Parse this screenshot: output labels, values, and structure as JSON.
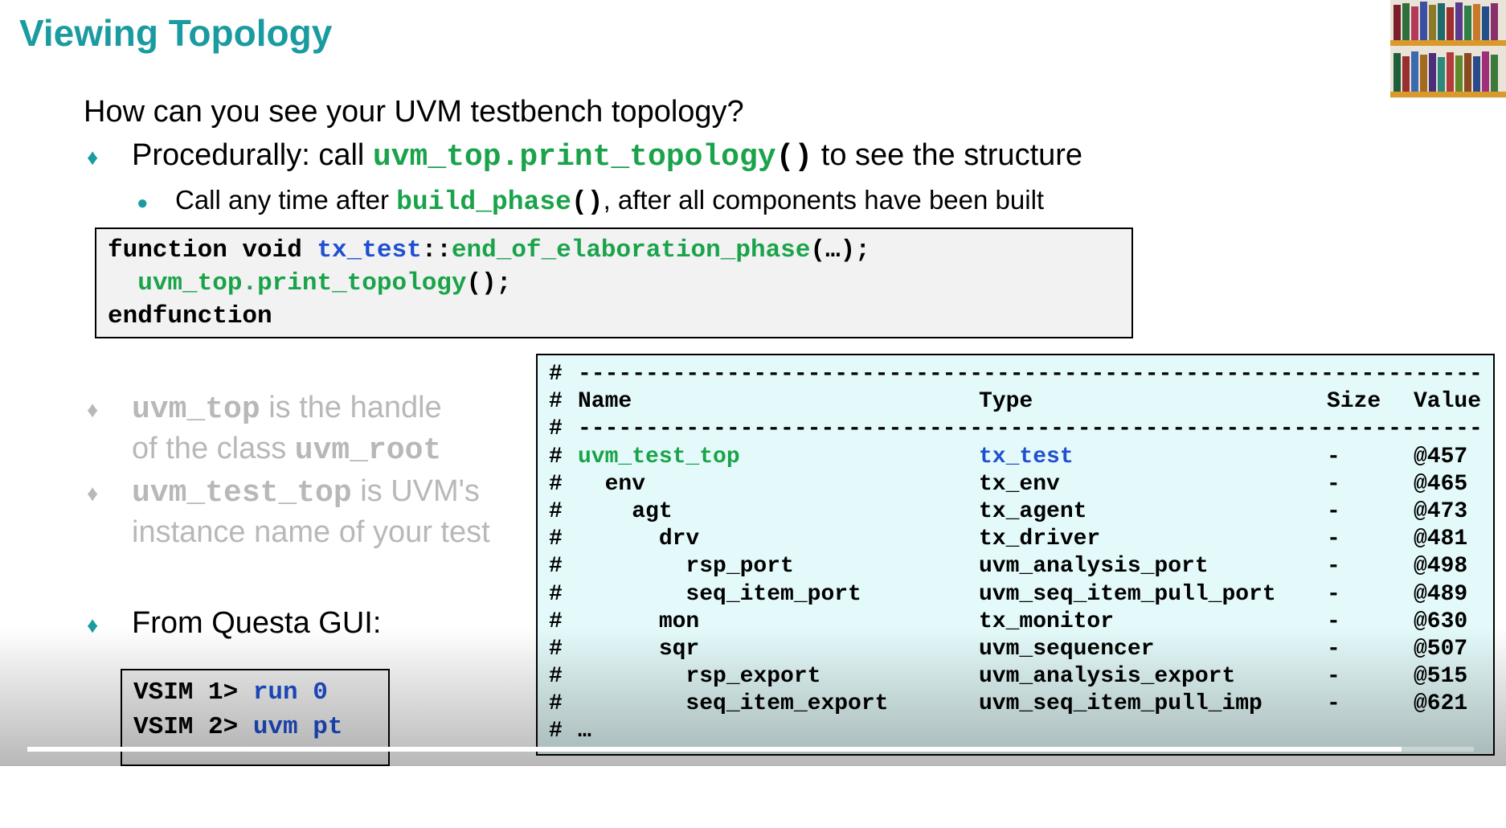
{
  "slide": {
    "title": "Viewing Topology",
    "question": "How can you see your UVM testbench topology?",
    "bullet1": {
      "prefix": "Procedurally: call ",
      "code": "uvm_top.print_topology",
      "parens": "()",
      "suffix": " to see the structure"
    },
    "sub1": {
      "prefix": "Call any time after ",
      "code": "build_phase",
      "parens": "()",
      "suffix": ", after all components have been built"
    },
    "code_block": {
      "l1_kw": "function void ",
      "l1_cls": "tx_test",
      "l1_sep": "::",
      "l1_fn": "end_of_elaboration_phase",
      "l1_tail": "(…);",
      "l2_obj": "uvm_top",
      "l2_dot": ".",
      "l2_fn": "print_topology",
      "l2_tail": "();",
      "l3": "endfunction"
    },
    "grey_bullet1": {
      "code1": "uvm_top",
      "text1": " is the handle",
      "text2": "of the class ",
      "code2": "uvm_root"
    },
    "grey_bullet2": {
      "code1": "uvm_test_top",
      "text1": " is UVM's",
      "text2": "instance name of your test"
    },
    "bullet3": "From Questa GUI:",
    "vsim": {
      "l1_prompt": "VSIM 1> ",
      "l1_cmd": "run 0",
      "l2_prompt": "VSIM 2> ",
      "l2_cmd": "uvm pt"
    },
    "topology": {
      "hash": "#",
      "dashes": "-------------------------------------------------------------------------",
      "header": {
        "name": "Name",
        "type": "Type",
        "size": "Size",
        "value": "Value"
      },
      "rows": [
        {
          "name": "uvm_test_top",
          "type": "tx_test",
          "size": "-",
          "value": "@457"
        },
        {
          "name": "  env",
          "type": "tx_env",
          "size": "-",
          "value": "@465"
        },
        {
          "name": "    agt",
          "type": "tx_agent",
          "size": "-",
          "value": "@473"
        },
        {
          "name": "      drv",
          "type": "tx_driver",
          "size": "-",
          "value": "@481"
        },
        {
          "name": "        rsp_port",
          "type": "uvm_analysis_port",
          "size": "-",
          "value": "@498"
        },
        {
          "name": "        seq_item_port",
          "type": "uvm_seq_item_pull_port",
          "size": "-",
          "value": "@489"
        },
        {
          "name": "      mon",
          "type": "tx_monitor",
          "size": "-",
          "value": "@630"
        },
        {
          "name": "      sqr",
          "type": "uvm_sequencer",
          "size": "-",
          "value": "@507"
        },
        {
          "name": "        rsp_export",
          "type": "uvm_analysis_export",
          "size": "-",
          "value": "@515"
        },
        {
          "name": "        seq_item_export",
          "type": "uvm_seq_item_pull_imp",
          "size": "-",
          "value": "@621"
        }
      ],
      "ellipsis": "…"
    }
  },
  "player": {
    "progress": 0.95
  },
  "colors": {
    "title": "#1a9ba0",
    "code_green": "#1aa34a",
    "code_blue": "#1f4fd1",
    "faded": "#b8b8b8",
    "topology_bg": "#e4fafa"
  }
}
